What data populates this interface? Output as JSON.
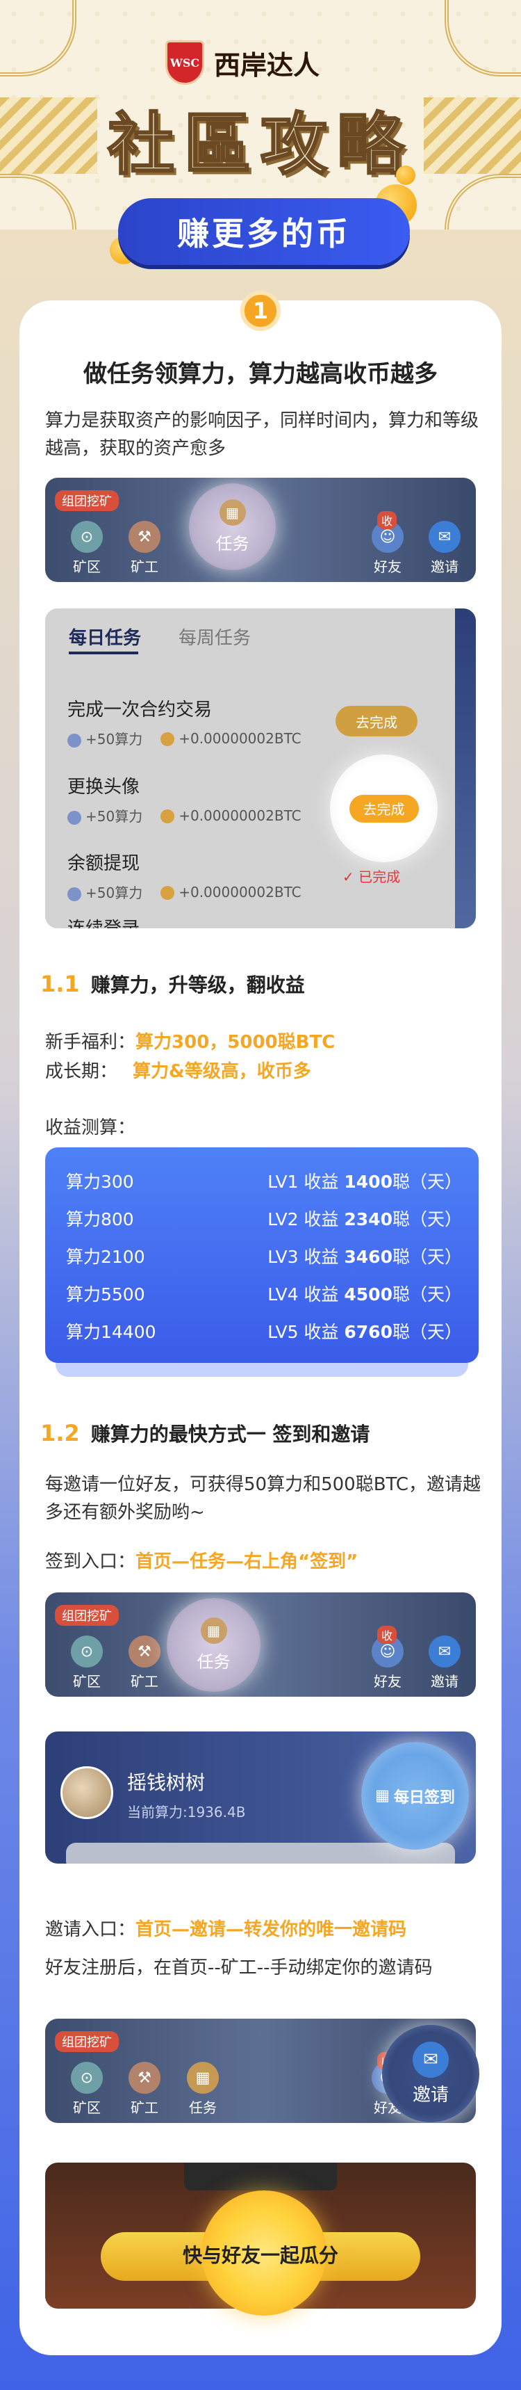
{
  "header": {
    "logo_text": "WSC",
    "brand": "西岸达人",
    "title": "社區攻略",
    "ribbon": "赚更多的币"
  },
  "step1": {
    "num": "1",
    "title": "做任务领算力，算力越高收币越多",
    "desc": "算力是获取资产的影响因子，同样时间内，算力和等级越高，获取的资产愈多"
  },
  "nav": {
    "tag": "组团挖矿",
    "items": [
      "矿区",
      "矿工",
      "任务",
      "好友",
      "邀请"
    ],
    "badge": "收",
    "highlight_task": "任务",
    "highlight_invite": "邀请"
  },
  "tasks": {
    "tab_daily": "每日任务",
    "tab_weekly": "每周任务",
    "items": [
      {
        "name": "完成一次合约交易",
        "power": "+50算力",
        "btc": "+0.00000002BTC",
        "action": "去完成"
      },
      {
        "name": "更换头像",
        "power": "+50算力",
        "btc": "+0.00000002BTC",
        "action": "去完成"
      },
      {
        "name": "余额提现",
        "power": "+50算力",
        "btc": "+0.00000002BTC",
        "action": "已完成"
      },
      {
        "name": "连续登录",
        "power": "",
        "btc": "",
        "action": ""
      }
    ]
  },
  "s11": {
    "num": "1.1",
    "title": "赚算力，升等级，翻收益",
    "newbie_label": "新手福利：",
    "newbie_value": "算力300，5000聪BTC",
    "grow_label": "成长期：",
    "grow_value": "算力&等级高，收币多",
    "calc_label": "收益测算："
  },
  "earnings": [
    {
      "power": "算力300",
      "level": "LV1 收益",
      "amount": "1400",
      "unit": "聪（天）"
    },
    {
      "power": "算力800",
      "level": "LV2 收益",
      "amount": "2340",
      "unit": "聪（天）"
    },
    {
      "power": "算力2100",
      "level": "LV3 收益",
      "amount": "3460",
      "unit": "聪（天）"
    },
    {
      "power": "算力5500",
      "level": "LV4 收益",
      "amount": "4500",
      "unit": "聪（天）"
    },
    {
      "power": "算力14400",
      "level": "LV5 收益",
      "amount": "6760",
      "unit": "聪（天）"
    }
  ],
  "s12": {
    "num": "1.2",
    "title": "赚算力的最快方式一 签到和邀请",
    "desc": "每邀请一位好友，可获得50算力和500聪BTC，邀请越多还有额外奖励哟~",
    "signin_label": "签到入口：",
    "signin_value": "首页—任务—右上角“签到”",
    "invite_label": "邀请入口：",
    "invite_value": "首页—邀请—转发你的唯一邀请码",
    "bind_text": "好友注册后，在首页--矿工--手动绑定你的邀请码"
  },
  "tree": {
    "name": "摇钱树树",
    "power": "当前算力:1936.4B",
    "signin_btn": "每日签到"
  },
  "scene": {
    "button": "快与好友一起瓜分"
  }
}
